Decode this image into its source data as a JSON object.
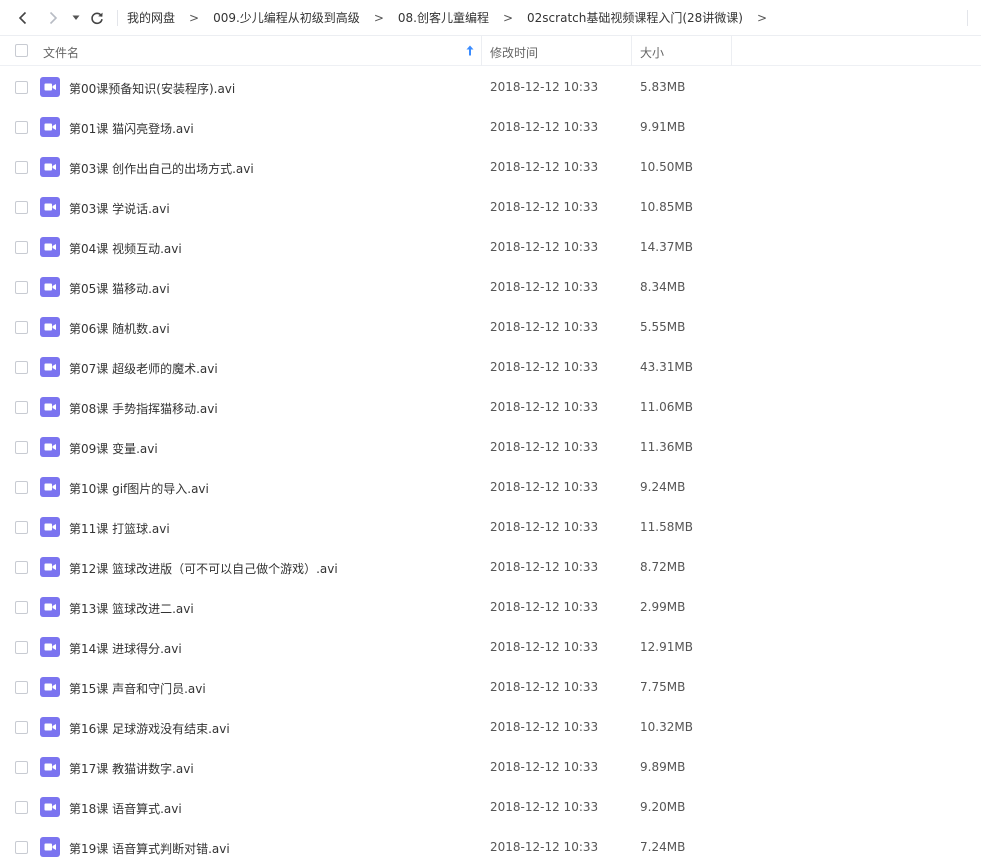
{
  "nav": {
    "back_icon": "chevron-left-icon",
    "forward_icon": "chevron-right-icon",
    "dropdown_icon": "caret-down-icon",
    "refresh_icon": "refresh-icon",
    "breadcrumb": [
      "我的网盘",
      "009.少儿编程从初级到高级",
      "08.创客儿童编程",
      "02scratch基础视频课程入门(28讲微课)"
    ],
    "separator": ">"
  },
  "header": {
    "name_label": "文件名",
    "mtime_label": "修改时间",
    "size_label": "大小",
    "sort_icon": "sort-arrow-up-icon"
  },
  "colors": {
    "accent": "#3b8cff",
    "video_icon": "#7b74f0",
    "divider": "#eceef2"
  },
  "files": [
    {
      "name": "第00课预备知识(安装程序).avi",
      "mtime": "2018-12-12 10:33",
      "size": "5.83MB"
    },
    {
      "name": "第01课 猫闪亮登场.avi",
      "mtime": "2018-12-12 10:33",
      "size": "9.91MB"
    },
    {
      "name": "第03课 创作出自己的出场方式.avi",
      "mtime": "2018-12-12 10:33",
      "size": "10.50MB"
    },
    {
      "name": "第03课 学说话.avi",
      "mtime": "2018-12-12 10:33",
      "size": "10.85MB"
    },
    {
      "name": "第04课 视频互动.avi",
      "mtime": "2018-12-12 10:33",
      "size": "14.37MB"
    },
    {
      "name": "第05课 猫移动.avi",
      "mtime": "2018-12-12 10:33",
      "size": "8.34MB"
    },
    {
      "name": "第06课 随机数.avi",
      "mtime": "2018-12-12 10:33",
      "size": "5.55MB"
    },
    {
      "name": "第07课 超级老师的魔术.avi",
      "mtime": "2018-12-12 10:33",
      "size": "43.31MB"
    },
    {
      "name": "第08课 手势指挥猫移动.avi",
      "mtime": "2018-12-12 10:33",
      "size": "11.06MB"
    },
    {
      "name": "第09课 变量.avi",
      "mtime": "2018-12-12 10:33",
      "size": "11.36MB"
    },
    {
      "name": "第10课 gif图片的导入.avi",
      "mtime": "2018-12-12 10:33",
      "size": "9.24MB"
    },
    {
      "name": "第11课 打篮球.avi",
      "mtime": "2018-12-12 10:33",
      "size": "11.58MB"
    },
    {
      "name": "第12课 篮球改进版（可不可以自己做个游戏）.avi",
      "mtime": "2018-12-12 10:33",
      "size": "8.72MB"
    },
    {
      "name": "第13课 篮球改进二.avi",
      "mtime": "2018-12-12 10:33",
      "size": "2.99MB"
    },
    {
      "name": "第14课 进球得分.avi",
      "mtime": "2018-12-12 10:33",
      "size": "12.91MB"
    },
    {
      "name": "第15课 声音和守门员.avi",
      "mtime": "2018-12-12 10:33",
      "size": "7.75MB"
    },
    {
      "name": "第16课 足球游戏没有结束.avi",
      "mtime": "2018-12-12 10:33",
      "size": "10.32MB"
    },
    {
      "name": "第17课 教猫讲数字.avi",
      "mtime": "2018-12-12 10:33",
      "size": "9.89MB"
    },
    {
      "name": "第18课 语音算式.avi",
      "mtime": "2018-12-12 10:33",
      "size": "9.20MB"
    },
    {
      "name": "第19课 语音算式判断对错.avi",
      "mtime": "2018-12-12 10:33",
      "size": "7.24MB"
    }
  ]
}
